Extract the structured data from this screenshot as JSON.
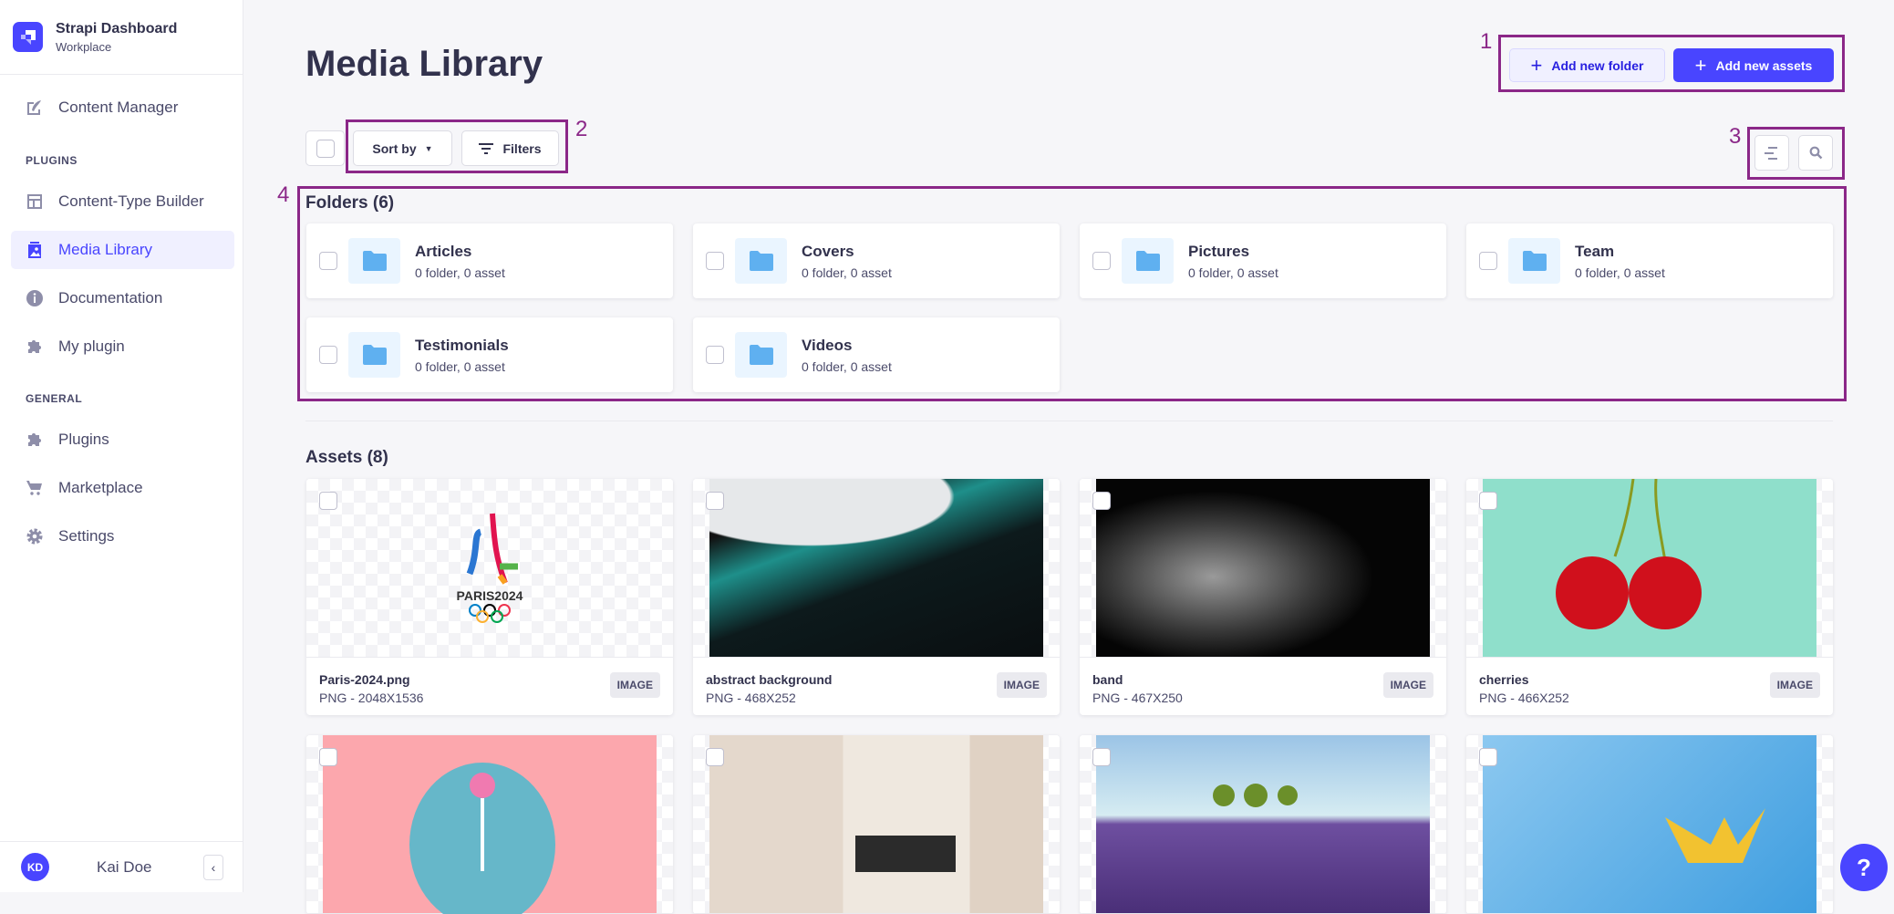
{
  "sidebar": {
    "brand_title": "Strapi Dashboard",
    "brand_subtitle": "Workplace",
    "items": [
      {
        "label": "Content Manager",
        "icon": "feather-icon"
      },
      {
        "label": "Content-Type Builder",
        "icon": "layout-icon"
      },
      {
        "label": "Media Library",
        "icon": "picture-icon",
        "active": true
      },
      {
        "label": "Documentation",
        "icon": "info-icon"
      },
      {
        "label": "My plugin",
        "icon": "puzzle-icon"
      },
      {
        "label": "Plugins",
        "icon": "puzzle-icon"
      },
      {
        "label": "Marketplace",
        "icon": "cart-icon"
      },
      {
        "label": "Settings",
        "icon": "gear-icon"
      }
    ],
    "sections": {
      "plugins": "PLUGINS",
      "general": "GENERAL"
    },
    "user": {
      "initials": "KD",
      "name": "Kai Doe"
    }
  },
  "header": {
    "title": "Media Library",
    "add_folder": "Add new folder",
    "add_assets": "Add new assets"
  },
  "toolbar": {
    "sort": "Sort by",
    "filters": "Filters"
  },
  "annotations": [
    "1",
    "2",
    "3",
    "4"
  ],
  "folders": {
    "heading": "Folders (6)",
    "items": [
      {
        "name": "Articles",
        "meta": "0 folder, 0 asset"
      },
      {
        "name": "Covers",
        "meta": "0 folder, 0 asset"
      },
      {
        "name": "Pictures",
        "meta": "0 folder, 0 asset"
      },
      {
        "name": "Team",
        "meta": "0 folder, 0 asset"
      },
      {
        "name": "Testimonials",
        "meta": "0 folder, 0 asset"
      },
      {
        "name": "Videos",
        "meta": "0 folder, 0 asset"
      }
    ]
  },
  "assets": {
    "heading": "Assets (8)",
    "items": [
      {
        "name": "Paris-2024.png",
        "meta": "PNG - 2048X1536",
        "type": "IMAGE",
        "logo_text": "PARIS2024"
      },
      {
        "name": "abstract background",
        "meta": "PNG - 468X252",
        "type": "IMAGE"
      },
      {
        "name": "band",
        "meta": "PNG - 467X250",
        "type": "IMAGE"
      },
      {
        "name": "cherries",
        "meta": "PNG - 466X252",
        "type": "IMAGE"
      },
      {},
      {},
      {},
      {}
    ]
  },
  "help": "?",
  "colors": {
    "primary": "#4945ff",
    "annotation": "#8b2788",
    "folder": "#5fb0f0"
  }
}
